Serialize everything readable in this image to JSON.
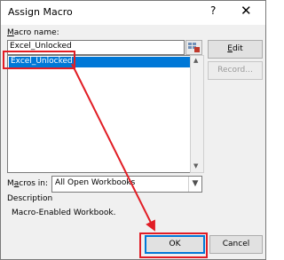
{
  "window": {
    "title": "Assign Macro",
    "help_label": "?",
    "close_label": "✕"
  },
  "macro_name": {
    "label": "Macro name:",
    "label_accesskey": "M",
    "label_rest": "acro name:",
    "value": "Excel_Unlocked"
  },
  "macro_list": {
    "items": [
      "Excel_Unlocked"
    ],
    "selected_index": 0
  },
  "buttons": {
    "edit": "Edit",
    "edit_accesskey": "E",
    "edit_rest": "dit",
    "record": "Record...",
    "ok": "OK",
    "cancel": "Cancel"
  },
  "macros_in": {
    "label": "Macros in:",
    "label_prefix": "M",
    "label_accesskey": "a",
    "label_rest": "cros in:",
    "value": "All Open Workbooks"
  },
  "description": {
    "heading": "Description",
    "text": "Macro-Enabled Workbook."
  },
  "annotation": {
    "color": "#e11d25"
  },
  "icons": {
    "help": "help-icon",
    "close": "close-icon",
    "range_picker": "range-picker-icon",
    "dropdown": "chevron-down-icon",
    "annotation_arrow": "arrow-annotation"
  }
}
